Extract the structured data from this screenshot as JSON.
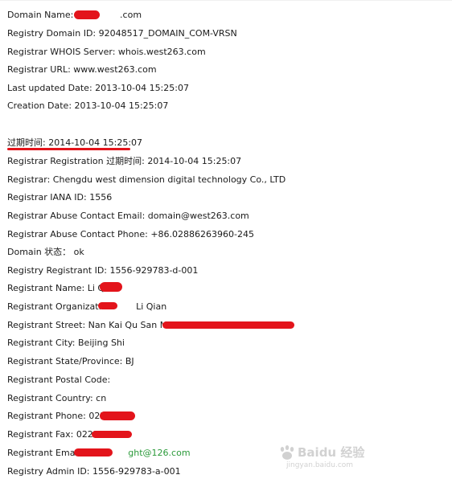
{
  "whois_record": {
    "domain_name": "Domain Name: dym",
    "domain_name_tail": ".com",
    "registry_domain_id": "Registry Domain ID: 92048517_DOMAIN_COM-VRSN",
    "registrar_whois_server": "Registrar WHOIS Server: whois.west263.com",
    "registrar_url": "Registrar URL: www.west263.com",
    "last_updated": "Last updated Date: 2013-10-04 15:25:07",
    "creation_date": "Creation Date: 2013-10-04 15:25:07",
    "expiry_date": "过期时间: 2014-10-04 15:25:07",
    "registrar_registration_expiry": "Registrar Registration 过期时间: 2014-10-04 15:25:07",
    "registrar": "Registrar: Chengdu west dimension digital technology Co., LTD",
    "registrar_iana_id": "Registrar IANA ID: 1556",
    "registrar_abuse_email": "Registrar Abuse Contact Email: domain@west263.com",
    "registrar_abuse_phone": "Registrar Abuse Contact Phone: +86.02886263960-245",
    "domain_status": "Domain 状态： ok",
    "registry_registrant_id": "Registry Registrant ID: 1556-929783-d-001",
    "registrant_name": "Registrant Name: Li Qian",
    "registrant_organization_label": "Registrant Organization:",
    "registrant_organization_value": "Li Qian",
    "registrant_street": "Registrant Street: Nan Kai Qu San Ma Lu",
    "registrant_city": "Registrant City: Beijing Shi",
    "registrant_state": "Registrant State/Province: BJ",
    "registrant_postal_code": "Registrant Postal Code:",
    "registrant_country": "Registrant Country: cn",
    "registrant_phone": "Registrant Phone: 02223",
    "registrant_fax": "Registrant Fax: 02223",
    "registrant_email_label": "Registrant Email:",
    "registrant_email_tail": "ght@126.com",
    "registry_admin_id": "Registry Admin ID: 1556-929783-a-001"
  },
  "watermark": {
    "brand": "Baidu 经验",
    "url": "jingyan.baidu.com"
  },
  "colors": {
    "text": "#1a1a1a",
    "redaction": "#e3141b",
    "email_link": "#2b9a3a",
    "background": "#ffffff"
  }
}
